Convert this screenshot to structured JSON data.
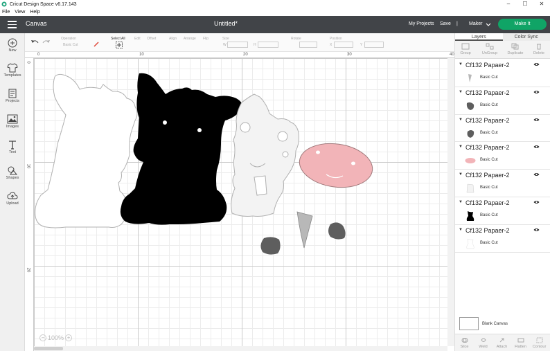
{
  "window": {
    "title": "Cricut Design Space  v6.17.143",
    "controls": [
      "–",
      "☐",
      "✕"
    ]
  },
  "menu": [
    "File",
    "View",
    "Help"
  ],
  "appbar": {
    "section": "Canvas",
    "document_title": "Untitled*",
    "my_projects": "My Projects",
    "save": "Save",
    "separator": "|",
    "machine": "Maker",
    "make_it": "Make It",
    "make_it_color": "#10a466"
  },
  "left_tools": [
    {
      "label": "New",
      "icon": "plus-circle-icon"
    },
    {
      "label": "Templates",
      "icon": "shirt-icon"
    },
    {
      "label": "Projects",
      "icon": "projects-icon"
    },
    {
      "label": "Images",
      "icon": "image-icon"
    },
    {
      "label": "Text",
      "icon": "text-icon"
    },
    {
      "label": "Shapes",
      "icon": "shapes-icon"
    },
    {
      "label": "Upload",
      "icon": "upload-cloud-icon"
    }
  ],
  "edit_toolbar": {
    "operation_label": "Operation",
    "operation_value": "Basic Cut",
    "select_all": "Select All",
    "edit": "Edit",
    "offset": "Offset",
    "align": "Align",
    "arrange": "Arrange",
    "flip": "Flip",
    "size": "Size",
    "size_w": "W",
    "size_h": "H",
    "rotate": "Rotate",
    "position": "Position",
    "position_x": "X",
    "position_y": "Y"
  },
  "ruler": {
    "horizontal": [
      "0",
      "10",
      "20",
      "30",
      "40"
    ],
    "vertical": [
      "0",
      "10",
      "20"
    ]
  },
  "zoom": {
    "minus": "−",
    "value": "100%",
    "plus": "+"
  },
  "panel": {
    "tabs": [
      "Layers",
      "Color Sync"
    ],
    "actions": [
      "Group",
      "UnGroup",
      "Duplicate",
      "Delete"
    ],
    "layers": [
      {
        "name": "Cf132 Papaer-2",
        "operation": "Basic Cut",
        "thumb_color": "#b8b8b8"
      },
      {
        "name": "Cf132 Papaer-2",
        "operation": "Basic Cut",
        "thumb_color": "#5e5e5e"
      },
      {
        "name": "Cf132 Papaer-2",
        "operation": "Basic Cut",
        "thumb_color": "#5e5e5e"
      },
      {
        "name": "Cf132 Papaer-2",
        "operation": "Basic Cut",
        "thumb_color": "#f2b4b8"
      },
      {
        "name": "Cf132 Papaer-2",
        "operation": "Basic Cut",
        "thumb_color": "#f3f3f3"
      },
      {
        "name": "Cf132 Papaer-2",
        "operation": "Basic Cut",
        "thumb_color": "#000000"
      },
      {
        "name": "Cf132 Papaer-2",
        "operation": "Basic Cut",
        "thumb_color": "#ffffff"
      }
    ],
    "blank_canvas": "Blank Canvas",
    "bottom_actions": [
      "Slice",
      "Weld",
      "Attach",
      "Flatten",
      "Contour"
    ]
  },
  "colors": {
    "appbar": "#414448",
    "cow_black": "#000000",
    "cow_white": "#ffffff",
    "spots_light": "#f3f3f3",
    "nose_pink": "#f2b4b8",
    "hoof_grey": "#5e5e5e",
    "horn_grey": "#b8b8b8"
  }
}
